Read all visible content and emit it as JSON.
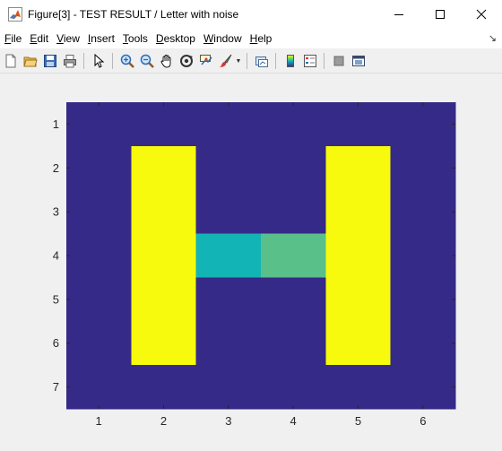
{
  "window": {
    "title": "Figure[3] - TEST RESULT / Letter with noise",
    "minimize_icon": "minimize-icon",
    "maximize_icon": "maximize-icon",
    "close_icon": "close-icon"
  },
  "menu": {
    "items": [
      {
        "key": "F",
        "rest": "ile"
      },
      {
        "key": "E",
        "rest": "dit"
      },
      {
        "key": "V",
        "rest": "iew"
      },
      {
        "key": "I",
        "rest": "nsert"
      },
      {
        "key": "T",
        "rest": "ools"
      },
      {
        "key": "D",
        "rest": "esktop"
      },
      {
        "key": "W",
        "rest": "indow"
      },
      {
        "key": "H",
        "rest": "elp"
      }
    ]
  },
  "toolbar": {
    "icons": [
      "new-figure-icon",
      "open-file-icon",
      "save-icon",
      "print-icon",
      "edit-plot-icon",
      "zoom-in-icon",
      "zoom-out-icon",
      "pan-icon",
      "rotate-3d-icon",
      "data-cursor-icon",
      "brush-icon",
      "link-plot-icon",
      "insert-colorbar-icon",
      "insert-legend-icon",
      "hide-plot-tools-icon",
      "show-plot-tools-icon"
    ]
  },
  "colors": {
    "background_cell": "#352a87",
    "letter_cell": "#f8fa0d",
    "noise_teal": "#13b4b5",
    "noise_green": "#5ac08a"
  },
  "chart_data": {
    "type": "heatmap",
    "title": "",
    "xlabel": "",
    "ylabel": "",
    "x_ticks": [
      1,
      2,
      3,
      4,
      5,
      6
    ],
    "y_ticks": [
      1,
      2,
      3,
      4,
      5,
      6,
      7
    ],
    "xlim": [
      0.5,
      6.5
    ],
    "ylim": [
      0.5,
      7.5
    ],
    "y_direction": "reverse",
    "grid": false,
    "legend": "none",
    "colormap": "parula",
    "clim": [
      0,
      1
    ],
    "values": [
      [
        0,
        0,
        0,
        0,
        0,
        0
      ],
      [
        0,
        1,
        0,
        0,
        1,
        0
      ],
      [
        0,
        1,
        0,
        0,
        1,
        0
      ],
      [
        0,
        1,
        0.5,
        0.62,
        1,
        0
      ],
      [
        0,
        1,
        0,
        0,
        1,
        0
      ],
      [
        0,
        1,
        0,
        0,
        1,
        0
      ],
      [
        0,
        0,
        0,
        0,
        0,
        0
      ]
    ]
  }
}
